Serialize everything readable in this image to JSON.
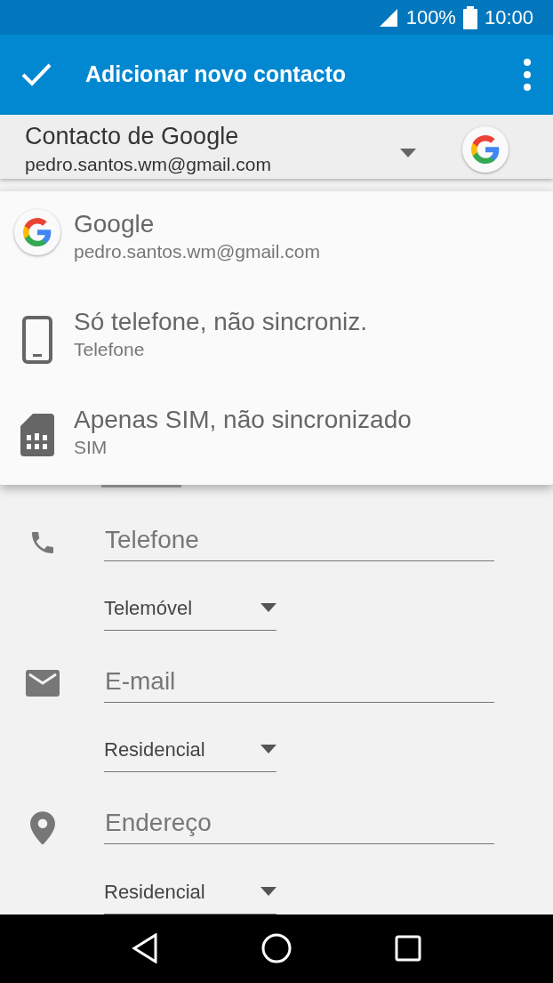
{
  "status_bar": {
    "battery": "100%",
    "time": "10:00"
  },
  "app_bar": {
    "title": "Adicionar novo contacto"
  },
  "account": {
    "name": "Contacto de Google",
    "email": "pedro.santos.wm@gmail.com"
  },
  "account_menu": {
    "items": [
      {
        "kind": "google",
        "title": "Google",
        "subtitle": "pedro.santos.wm@gmail.com"
      },
      {
        "kind": "phone",
        "title": "Só telefone, não sincroniz.",
        "subtitle": "Telefone"
      },
      {
        "kind": "sim",
        "title": "Apenas SIM, não sincronizado",
        "subtitle": "SIM"
      }
    ]
  },
  "fields": [
    {
      "kind": "phone",
      "placeholder": "Telefone",
      "type_label": "Telemóvel"
    },
    {
      "kind": "email",
      "placeholder": "E-mail",
      "type_label": "Residencial"
    },
    {
      "kind": "address",
      "placeholder": "Endereço",
      "type_label": "Residencial"
    }
  ]
}
